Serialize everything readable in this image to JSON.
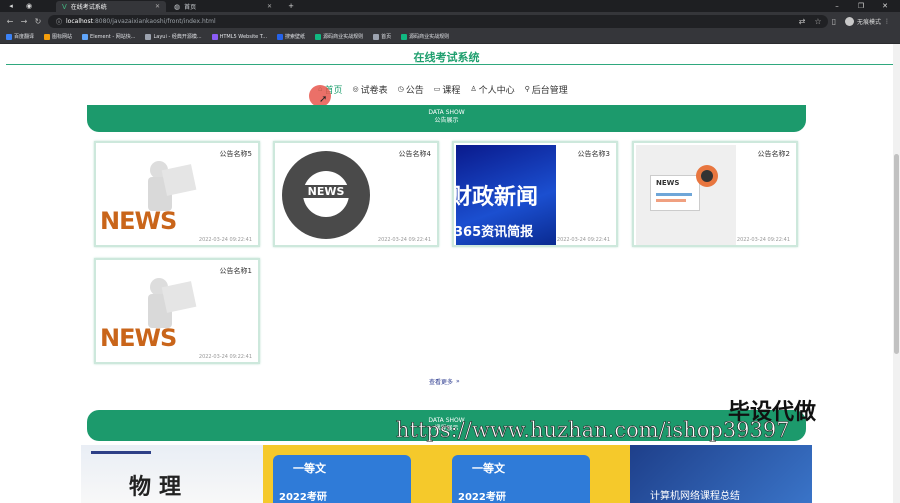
{
  "browser": {
    "tabs": [
      {
        "label": "在线考试系统",
        "active": true
      },
      {
        "label": "首页",
        "active": false
      }
    ],
    "new_tab": "+",
    "address": {
      "host": "localhost",
      "path": ":8080/javazaixiankaoshi/front/index.html"
    },
    "profile_label": "无痕模式",
    "bookmarks": [
      {
        "label": "百度翻译",
        "color": "#3b82f6"
      },
      {
        "label": "图标网站",
        "color": "#f59e0b"
      },
      {
        "label": "Element - 网站快...",
        "color": "#60a5fa"
      },
      {
        "label": "Layui - 经典开源模...",
        "color": "#9ca3af"
      },
      {
        "label": "HTML5 Website T...",
        "color": "#8b5cf6"
      },
      {
        "label": "搜索壁纸",
        "color": "#2563eb"
      },
      {
        "label": "源码商业实战规则",
        "color": "#10b981"
      },
      {
        "label": "首页",
        "color": "#9ca3af"
      },
      {
        "label": "源码商业实战规则",
        "color": "#10b981"
      }
    ]
  },
  "site": {
    "title": "在线考试系统",
    "menu": [
      {
        "label": "首页",
        "icon": "home-icon",
        "glyph": "⌂",
        "active": true
      },
      {
        "label": "试卷表",
        "icon": "paper-icon",
        "glyph": "◎",
        "active": false
      },
      {
        "label": "公告",
        "icon": "clock-icon",
        "glyph": "◷",
        "active": false
      },
      {
        "label": "课程",
        "icon": "book-icon",
        "glyph": "▭",
        "active": false
      },
      {
        "label": "个人中心",
        "icon": "user-icon",
        "glyph": "♙",
        "active": false
      },
      {
        "label": "后台管理",
        "icon": "link-icon",
        "glyph": "⚲",
        "active": false
      }
    ]
  },
  "notice_section": {
    "header_en": "DATA SHOW",
    "header_zh": "公告展示",
    "cards": [
      {
        "name": "公告名称5",
        "time": "2022-03-24 09:22:41",
        "image": "news-figure"
      },
      {
        "name": "公告名称4",
        "time": "2022-03-24 09:22:41",
        "image": "news-globe"
      },
      {
        "name": "公告名称3",
        "time": "2022-03-24 09:22:41",
        "image": "finance-news"
      },
      {
        "name": "公告名称2",
        "time": "2022-03-24 09:22:41",
        "image": "news-paper"
      },
      {
        "name": "公告名称1",
        "time": "2022-03-24 09:22:41",
        "image": "news-figure"
      }
    ],
    "more_label": "查看更多",
    "news_word": "NEWS",
    "finance_text": "财政新闻",
    "finance_sub": "365资讯简报"
  },
  "course_section": {
    "header_en": "DATA SHOW",
    "header_zh": "课程展示",
    "courses": [
      {
        "title": "物理",
        "kind": "physics"
      },
      {
        "title": "一等文",
        "subtitle": "2022考研",
        "kind": "exam"
      },
      {
        "title": "一等文",
        "subtitle": "2022考研",
        "kind": "exam"
      },
      {
        "title": "计算机网络课程总结",
        "kind": "network"
      }
    ]
  },
  "watermark": {
    "text": "毕设代做",
    "url": "https://www.huzhan.com/ishop39397"
  }
}
